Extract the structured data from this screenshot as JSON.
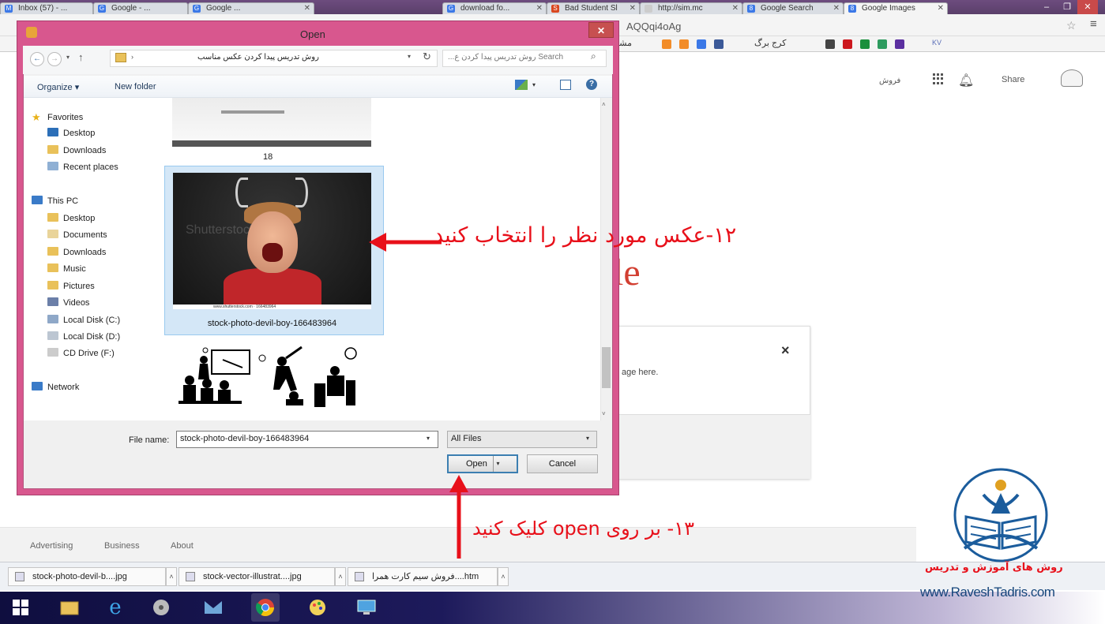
{
  "browser": {
    "tabs": [
      {
        "label": "Inbox (57) - ...",
        "active": false
      },
      {
        "label": "Google - ...",
        "active": false
      },
      {
        "label": "Google ...",
        "active": false
      },
      {
        "label": "download fo...",
        "active": false
      },
      {
        "label": "Bad Student Sl",
        "active": false
      },
      {
        "label": "http://sim.mc",
        "active": false
      },
      {
        "label": "Google Search",
        "active": false
      },
      {
        "label": "Google Images",
        "active": true
      }
    ],
    "address": "AQQqi4oAg",
    "bookmark_rtl_1": "مشاوره منابع",
    "bookmark_rtl_2": "کرج برگ",
    "bookmark_kv": "KV"
  },
  "page": {
    "header_user": "فروش",
    "share_label": "Share",
    "logo_tail": "le",
    "upload_hint": "age here.",
    "upload_close": "×",
    "footer_links": [
      "Advertising",
      "Business",
      "About"
    ]
  },
  "dialog": {
    "title": "Open",
    "breadcrumb": "روش تدریس پیدا کردن عکس مناسب",
    "search_placeholder": "Search روش تدریس پیدا کردن ع...",
    "toolbar": {
      "organize": "Organize ▾",
      "new_folder": "New folder"
    },
    "nav": {
      "favorites": "Favorites",
      "favorites_items": [
        "Desktop",
        "Downloads",
        "Recent places"
      ],
      "this_pc": "This PC",
      "pc_items": [
        "Desktop",
        "Documents",
        "Downloads",
        "Music",
        "Pictures",
        "Videos",
        "Local Disk (C:)",
        "Local Disk (D:)",
        "CD Drive (F:)"
      ],
      "network": "Network"
    },
    "files": {
      "item_18_label": "18",
      "selected_label": "stock-photo-devil-boy-166483964",
      "photo_watermark": "Shutterstock",
      "photo_caption": "www.shutterstock.com · 166483964"
    },
    "file_name_label": "File name:",
    "file_name_value": "stock-photo-devil-boy-166483964",
    "file_type": "All Files",
    "open_label": "Open",
    "cancel_label": "Cancel"
  },
  "downloads": [
    {
      "label": "stock-photo-devil-b....jpg"
    },
    {
      "label": "stock-vector-illustrat....jpg"
    },
    {
      "label": "فروش سیم کارت همرا....htm"
    }
  ],
  "annotations": {
    "step12": "۱۲-عکس مورد نظر را انتخاب کنید",
    "step13": "۱۳- بر روی open  کلیک کنید",
    "color": "#e8101a"
  },
  "brand": {
    "name": "روش های آموزش و تدریس",
    "url": "www.RaveshTadris.com"
  }
}
